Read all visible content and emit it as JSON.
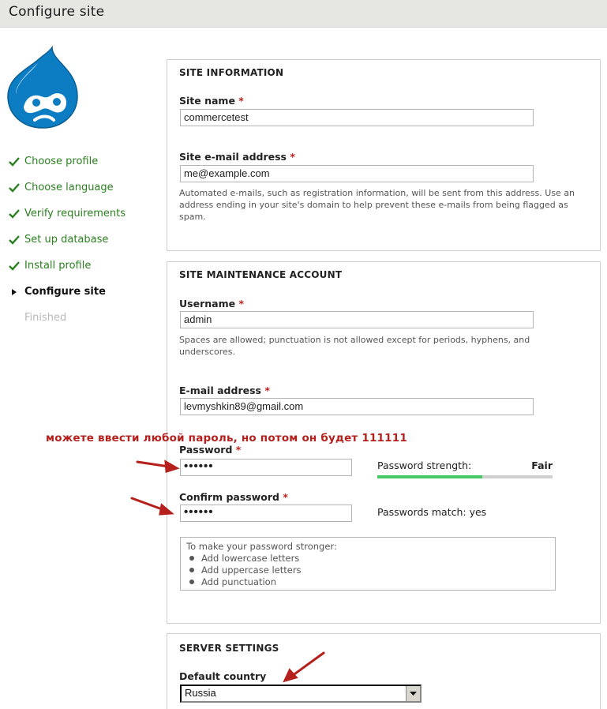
{
  "page": {
    "title": "Configure site"
  },
  "steps": [
    {
      "label": "Choose profile",
      "status": "done"
    },
    {
      "label": "Choose language",
      "status": "done"
    },
    {
      "label": "Verify requirements",
      "status": "done"
    },
    {
      "label": "Set up database",
      "status": "done"
    },
    {
      "label": "Install profile",
      "status": "done"
    },
    {
      "label": "Configure site",
      "status": "active"
    },
    {
      "label": "Finished",
      "status": "pending"
    }
  ],
  "site_info": {
    "legend": "SITE INFORMATION",
    "site_name_label": "Site name",
    "site_name_value": "commercetest",
    "email_label": "Site e-mail address",
    "email_value": "me@example.com",
    "email_desc": "Automated e-mails, such as registration information, will be sent from this address. Use an address ending in your site's domain to help prevent these e-mails from being flagged as spam."
  },
  "account": {
    "legend": "SITE MAINTENANCE ACCOUNT",
    "username_label": "Username",
    "username_value": "admin",
    "username_desc": "Spaces are allowed; punctuation is not allowed except for periods, hyphens, and underscores.",
    "email_label": "E-mail address",
    "email_value": "levmyshkin89@gmail.com",
    "password_label": "Password",
    "password_value": "••••••",
    "strength_label": "Password strength:",
    "strength_value": "Fair",
    "strength_fraction": 0.6,
    "confirm_label": "Confirm password",
    "confirm_value": "••••••",
    "match_text": "Passwords match: yes",
    "tips_title": "To make your password stronger:",
    "tips": [
      "Add lowercase letters",
      "Add uppercase letters",
      "Add punctuation"
    ]
  },
  "server": {
    "legend": "SERVER SETTINGS",
    "country_label": "Default country",
    "country_value": "Russia"
  },
  "required_mark": "*",
  "annotation": {
    "text": "можете ввести любой пароль, но потом он будет 111111"
  },
  "colors": {
    "accent_green": "#2a7f1f",
    "required_red": "#c0201a",
    "annotation_red": "#b5201d",
    "drupal_blue": "#0c7dc3",
    "strength_fill": "#47c964"
  }
}
